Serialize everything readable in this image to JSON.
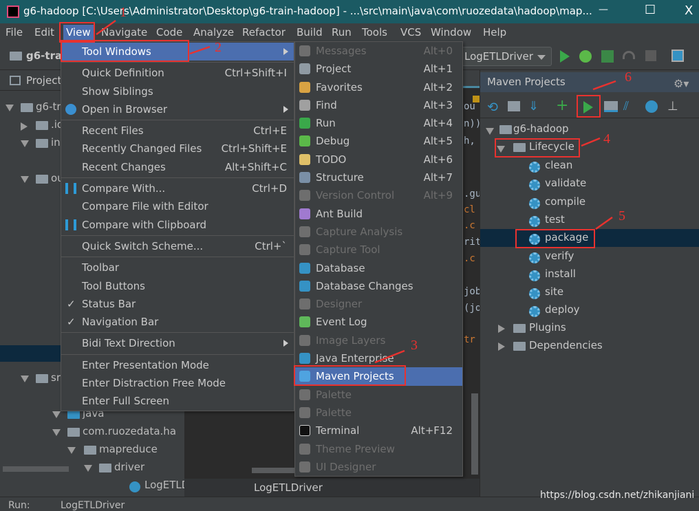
{
  "title": "g6-hadoop [C:\\Users\\Administrator\\Desktop\\g6-train-hadoop] - ...\\src\\main\\java\\com\\ruozedata\\hadoop\\map...",
  "window_controls": {
    "minimize": "—",
    "maximize": "☐",
    "close": "X"
  },
  "menubar": [
    "File",
    "Edit",
    "View",
    "Navigate",
    "Code",
    "Analyze",
    "Refactor",
    "Build",
    "Run",
    "Tools",
    "VCS",
    "Window",
    "Help"
  ],
  "toolbar": {
    "project_label": "g6-trai",
    "run_config": "LogETLDriver"
  },
  "project_panel": {
    "title": "Project",
    "rows": [
      "g6-tr",
      ".id",
      "in",
      "ou",
      "sr",
      "java",
      "com.ruozedata.ha",
      "mapreduce",
      "driver",
      "LogETLD"
    ]
  },
  "view_menu": [
    {
      "label": "Tool Windows",
      "submenu": true,
      "selected": true
    },
    {
      "sep": true
    },
    {
      "label": "Quick Definition",
      "shortcut": "Ctrl+Shift+I"
    },
    {
      "label": "Show Siblings"
    },
    {
      "label": "Open in Browser",
      "submenu": true,
      "icon": "globe-icon"
    },
    {
      "sep": true
    },
    {
      "label": "Recent Files",
      "shortcut": "Ctrl+E"
    },
    {
      "label": "Recently Changed Files",
      "shortcut": "Ctrl+Shift+E"
    },
    {
      "label": "Recent Changes",
      "shortcut": "Alt+Shift+C"
    },
    {
      "sep": true
    },
    {
      "label": "Compare With...",
      "shortcut": "Ctrl+D",
      "icon": "compare-icon"
    },
    {
      "label": "Compare File with Editor"
    },
    {
      "label": "Compare with Clipboard",
      "icon": "clipboard-compare-icon"
    },
    {
      "sep": true
    },
    {
      "label": "Quick Switch Scheme...",
      "shortcut": "Ctrl+`"
    },
    {
      "sep": true
    },
    {
      "label": "Toolbar"
    },
    {
      "label": "Tool Buttons"
    },
    {
      "label": "Status Bar",
      "checked": true
    },
    {
      "label": "Navigation Bar",
      "checked": true
    },
    {
      "sep": true
    },
    {
      "label": "Bidi Text Direction",
      "submenu": true
    },
    {
      "sep": true
    },
    {
      "label": "Enter Presentation Mode"
    },
    {
      "label": "Enter Distraction Free Mode"
    },
    {
      "label": "Enter Full Screen"
    }
  ],
  "tool_windows_menu": [
    {
      "label": "Messages",
      "shortcut": "Alt+0",
      "disabled": true,
      "color": "#6e6e6e"
    },
    {
      "label": "Project",
      "shortcut": "Alt+1",
      "color": "#8f9aa3"
    },
    {
      "label": "Favorites",
      "shortcut": "Alt+2",
      "color": "#d9a343"
    },
    {
      "label": "Find",
      "shortcut": "Alt+3",
      "color": "#a0a0a0"
    },
    {
      "label": "Run",
      "shortcut": "Alt+4",
      "color": "#3aa84a"
    },
    {
      "label": "Debug",
      "shortcut": "Alt+5",
      "color": "#5bb949"
    },
    {
      "label": "TODO",
      "shortcut": "Alt+6",
      "color": "#e0c068"
    },
    {
      "label": "Structure",
      "shortcut": "Alt+7",
      "color": "#7a8fa6"
    },
    {
      "label": "Version Control",
      "shortcut": "Alt+9",
      "disabled": true,
      "color": "#6e6e6e"
    },
    {
      "label": "Ant Build",
      "color": "#a07ad0"
    },
    {
      "label": "Capture Analysis",
      "disabled": true,
      "color": "#6e6e6e"
    },
    {
      "label": "Capture Tool",
      "disabled": true,
      "color": "#6e6e6e"
    },
    {
      "label": "Database",
      "color": "#3592c4"
    },
    {
      "label": "Database Changes",
      "color": "#3592c4"
    },
    {
      "label": "Designer",
      "disabled": true,
      "color": "#6e6e6e"
    },
    {
      "label": "Event Log",
      "color": "#5fb85a"
    },
    {
      "label": "Image Layers",
      "disabled": true,
      "color": "#6e6e6e"
    },
    {
      "label": "Java Enterprise",
      "color": "#3592c4"
    },
    {
      "label": "Maven Projects",
      "selected": true,
      "color": "#4fa3e0"
    },
    {
      "label": "Palette",
      "disabled": true,
      "color": "#6e6e6e"
    },
    {
      "label": "Palette",
      "disabled": true,
      "color": "#6e6e6e"
    },
    {
      "label": "Terminal",
      "shortcut": "Alt+F12",
      "color": "#111111"
    },
    {
      "label": "Theme Preview",
      "disabled": true,
      "color": "#6e6e6e"
    },
    {
      "label": "UI Designer",
      "disabled": true,
      "color": "#6e6e6e"
    }
  ],
  "editor_fragments": [
    "ou",
    "n))",
    "h,",
    ".gu",
    "cl",
    ".c",
    "rit",
    ".c",
    "job",
    "(jo",
    "tr"
  ],
  "editor_tab": "LogETLDriver",
  "maven": {
    "title": "Maven Projects",
    "project": "g6-hadoop",
    "lifecycle": "Lifecycle",
    "goals": [
      "clean",
      "validate",
      "compile",
      "test",
      "package",
      "verify",
      "install",
      "site",
      "deploy"
    ],
    "selected_goal": "package",
    "plugins": "Plugins",
    "dependencies": "Dependencies"
  },
  "status": {
    "run_label": "Run:",
    "run_tab": "LogETLDriver"
  },
  "annotations": [
    "1",
    "2",
    "3",
    "4",
    "5",
    "6"
  ],
  "watermark": "https://blog.csdn.net/zhikanjiani",
  "colors": {
    "accent": "#4b6eaf",
    "annotation": "#e8322f",
    "selection": "#0d293e"
  }
}
